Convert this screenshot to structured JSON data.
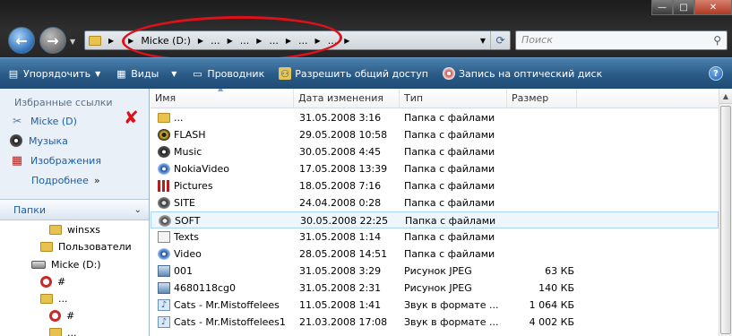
{
  "address": {
    "crumbs": [
      "Micke (D:)",
      "...",
      "...",
      "...",
      "...",
      "..."
    ]
  },
  "search": {
    "placeholder": "Поиск"
  },
  "toolbar": {
    "organize": "Упорядочить",
    "views": "Виды",
    "explorer": "Проводник",
    "share": "Разрешить общий доступ",
    "burn": "Запись на оптический диск"
  },
  "nav": {
    "favorites_header": "Избранные ссылки",
    "favorites": [
      {
        "label": "Micke (D)"
      },
      {
        "label": "Музыка"
      },
      {
        "label": "Изображения"
      }
    ],
    "more": "Подробнее",
    "folders_header": "Папки",
    "tree": [
      {
        "label": "winsxs"
      },
      {
        "label": "Пользователи"
      },
      {
        "label": "Micke (D:)"
      },
      {
        "label": "#"
      },
      {
        "label": "..."
      },
      {
        "label": "#"
      },
      {
        "label": "..."
      }
    ]
  },
  "columns": {
    "name": "Имя",
    "date": "Дата изменения",
    "type": "Тип",
    "size": "Размер"
  },
  "files": [
    {
      "name": "...",
      "date": "31.05.2008 3:16",
      "type": "Папка с файлами",
      "size": "",
      "icon": "folder-icon"
    },
    {
      "name": "FLASH",
      "date": "29.05.2008 10:58",
      "type": "Папка с файлами",
      "size": "",
      "icon": "radiation-icon"
    },
    {
      "name": "Music",
      "date": "30.05.2008 4:45",
      "type": "Папка с файлами",
      "size": "",
      "icon": "music-disc-icon"
    },
    {
      "name": "NokiaVideo",
      "date": "17.05.2008 13:39",
      "type": "Папка с файлами",
      "size": "",
      "icon": "video-disc-icon"
    },
    {
      "name": "Pictures",
      "date": "18.05.2008 7:16",
      "type": "Папка с файлами",
      "size": "",
      "icon": "pictures-icon"
    },
    {
      "name": "SITE",
      "date": "24.04.2008 0:28",
      "type": "Папка с файлами",
      "size": "",
      "icon": "globe-icon"
    },
    {
      "name": "SOFT",
      "date": "30.05.2008 22:25",
      "type": "Папка с файлами",
      "size": "",
      "icon": "soft-icon"
    },
    {
      "name": "Texts",
      "date": "31.05.2008 1:14",
      "type": "Папка с файлами",
      "size": "",
      "icon": "texts-icon"
    },
    {
      "name": "Video",
      "date": "28.05.2008 14:51",
      "type": "Папка с файлами",
      "size": "",
      "icon": "video-disc-icon"
    },
    {
      "name": "001",
      "date": "31.05.2008 3:29",
      "type": "Рисунок JPEG",
      "size": "63 КБ",
      "icon": "jpeg-icon"
    },
    {
      "name": "4680118cg0",
      "date": "31.05.2008 2:31",
      "type": "Рисунок JPEG",
      "size": "140 КБ",
      "icon": "jpeg-icon"
    },
    {
      "name": "Cats - Mr.Mistoffelees",
      "date": "11.05.2008 1:41",
      "type": "Звук в формате ...",
      "size": "1 064 КБ",
      "icon": "audio-file-icon"
    },
    {
      "name": "Cats - Mr.Mistoffelees1",
      "date": "21.03.2008 17:08",
      "type": "Звук в формате ...",
      "size": "4 002 КБ",
      "icon": "audio-file-icon"
    }
  ],
  "selected_index": 6,
  "colors": {
    "toolbar": "#2a5a86",
    "link": "#1b5ea6",
    "annotation": "#e0101a"
  }
}
